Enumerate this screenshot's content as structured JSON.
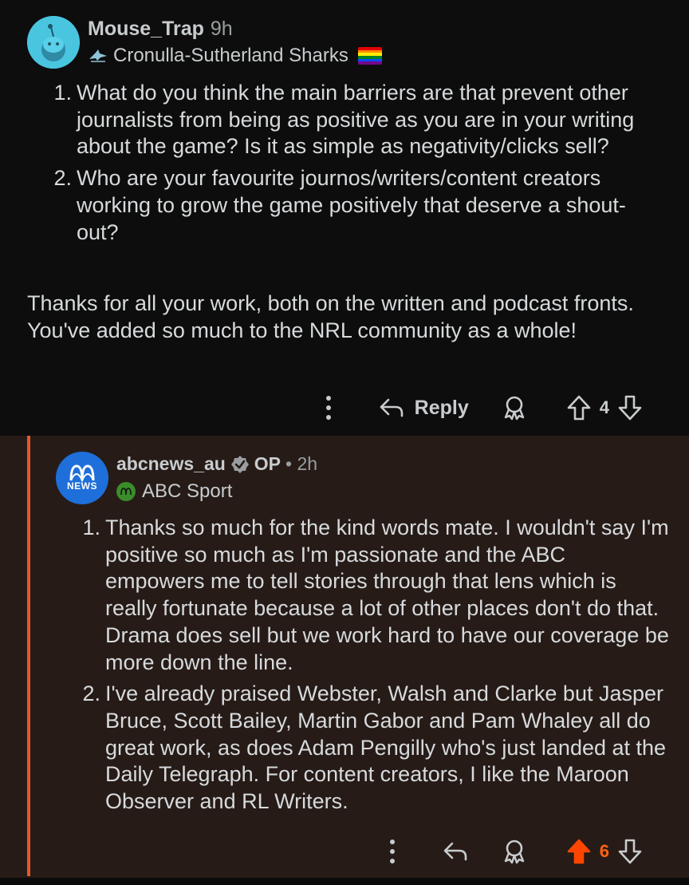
{
  "comment": {
    "username": "Mouse_Trap",
    "age": "9h",
    "flair": "Cronulla-Sutherland Sharks",
    "list": [
      {
        "num": "1.",
        "text": "What do you think the main barriers are that prevent other journalists from being as positive as you are in your writing about the game? Is it as simple as negativity/clicks sell?"
      },
      {
        "num": "2.",
        "text": "Who are your favourite journos/writers/content creators working to grow the game positively that deserve a shout-out?"
      }
    ],
    "paragraph": "Thanks for all your work, both on the written and podcast fronts. You've added so much to the NRL community as a whole!",
    "actions": {
      "reply_label": "Reply",
      "score": "4"
    }
  },
  "reply": {
    "avatar_text": "NEWS",
    "username": "abcnews_au",
    "op_label": "OP",
    "age": "• 2h",
    "flair": "ABC Sport",
    "list": [
      {
        "num": "1.",
        "text": "Thanks so much for the kind words mate. I wouldn't say I'm positive so much as I'm passionate and the ABC empowers me to tell stories through that lens which is really fortunate because a lot of other places don't do that. Drama does sell but we work hard to have our coverage be more down the line."
      },
      {
        "num": "2.",
        "text": "I've already praised Webster, Walsh and Clarke but Jasper Bruce, Scott Bailey, Martin Gabor and Pam Whaley all do great work, as does Adam Pengilly who's just landed at the Daily Telegraph. For content creators, I like the Maroon Observer and RL Writers."
      }
    ],
    "actions": {
      "score": "6"
    }
  },
  "colors": {
    "background": "#0b0b0b",
    "reply_background": "#261b17",
    "rail": "#e4572e",
    "upvoted": "#ff6314",
    "abc_blue": "#1e6fd9"
  }
}
